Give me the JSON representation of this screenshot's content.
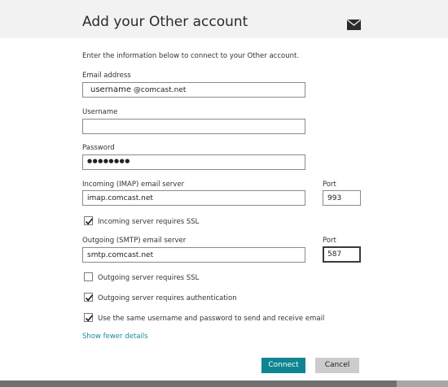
{
  "header": {
    "title": "Add your Other account",
    "icon": "mail-icon"
  },
  "form": {
    "intro": "Enter the information below to connect to your Other account.",
    "email": {
      "label": "Email address",
      "value_user": "username",
      "value_domain": "@comcast.net"
    },
    "username": {
      "label": "Username",
      "value": ""
    },
    "password": {
      "label": "Password",
      "value": "●●●●●●●●"
    },
    "incoming": {
      "label": "Incoming (IMAP) email server",
      "value": "imap.comcast.net",
      "port_label": "Port",
      "port_value": "993"
    },
    "incoming_ssl": {
      "label": "Incoming server requires SSL",
      "checked": true
    },
    "outgoing": {
      "label": "Outgoing (SMTP) email server",
      "value": "smtp.comcast.net",
      "port_label": "Port",
      "port_value": "587"
    },
    "outgoing_ssl": {
      "label": "Outgoing server requires SSL",
      "checked": false
    },
    "outgoing_auth": {
      "label": "Outgoing server requires authentication",
      "checked": true
    },
    "same_credentials": {
      "label": "Use the same username and password to send and receive email",
      "checked": true
    },
    "show_fewer_link": "Show fewer details"
  },
  "buttons": {
    "connect": "Connect",
    "cancel": "Cancel"
  },
  "colors": {
    "header_bg": "#f2f2f2",
    "accent": "#0e8591",
    "link": "#1b8c9c",
    "cancel_bg": "#cccccc"
  }
}
